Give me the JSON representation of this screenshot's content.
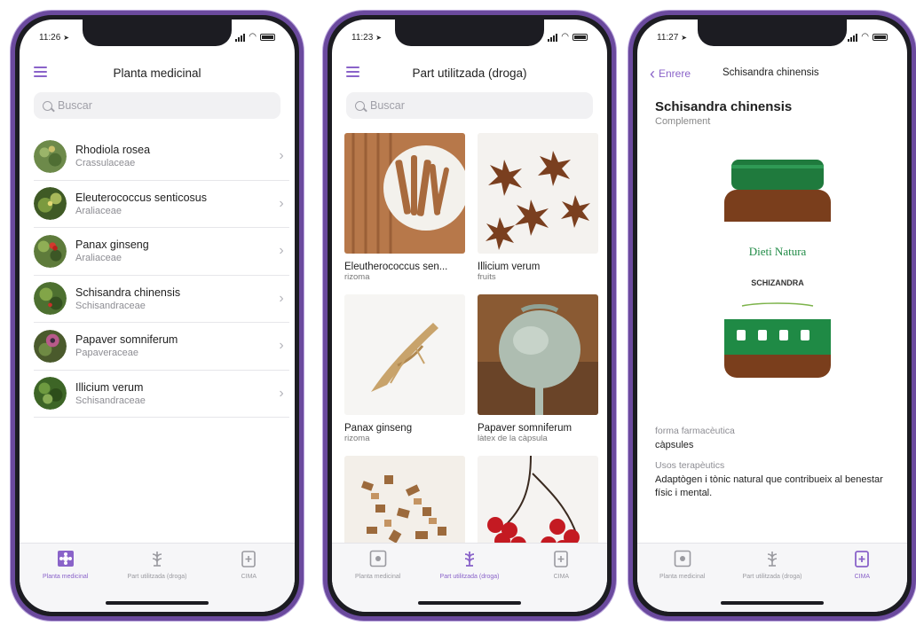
{
  "screen1": {
    "time": "11:26",
    "title": "Planta medicinal",
    "search_placeholder": "Buscar",
    "items": [
      {
        "name": "Rhodiola rosea",
        "family": "Crassulaceae"
      },
      {
        "name": "Eleuterococcus senticosus",
        "family": "Araliaceae"
      },
      {
        "name": "Panax ginseng",
        "family": "Araliaceae"
      },
      {
        "name": "Schisandra chinensis",
        "family": "Schisandraceae"
      },
      {
        "name": "Papaver somniferum",
        "family": "Papaveraceae"
      },
      {
        "name": "Illicium verum",
        "family": "Schisandraceae"
      }
    ],
    "tabs": [
      "Planta medicinal",
      "Part utilitzada (droga)",
      "CIMA"
    ]
  },
  "screen2": {
    "time": "11:23",
    "title": "Part utilitzada (droga)",
    "search_placeholder": "Buscar",
    "cards": [
      {
        "name": "Eleutherococcus sen...",
        "part": "rizoma"
      },
      {
        "name": "Illicium verum",
        "part": "fruits"
      },
      {
        "name": "Panax ginseng",
        "part": "rizoma"
      },
      {
        "name": "Papaver somniferum",
        "part": "làtex de la càpsula"
      }
    ],
    "tabs": [
      "Planta medicinal",
      "Part utilitzada (droga)",
      "CIMA"
    ]
  },
  "screen3": {
    "time": "11:27",
    "back_label": "Enrere",
    "nav_title": "Schisandra chinensis",
    "title": "Schisandra chinensis",
    "category": "Complement",
    "brand_text": "Dieti Natura",
    "product_text": "SCHIZANDRA",
    "fields": [
      {
        "label": "forma farmacèutica",
        "value": "càpsules"
      },
      {
        "label": "Usos terapèutics",
        "value": "Adaptògen i tònic natural que contribueix al benestar físic i mental."
      }
    ],
    "tabs": [
      "Planta medicinal",
      "Part utilitzada (droga)",
      "CIMA"
    ]
  },
  "colors": {
    "accent": "#8a63c9",
    "frame": "#6b4a9e",
    "inactive": "#9a9aa0"
  }
}
